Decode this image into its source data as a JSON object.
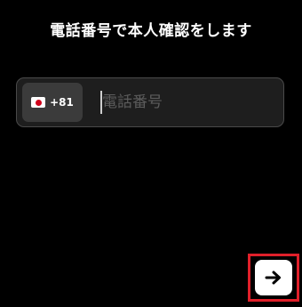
{
  "header": {
    "title": "電話番号で本人確認をします"
  },
  "phone": {
    "country": {
      "flag_icon": "japan-flag-icon",
      "dial_code": "+81"
    },
    "input": {
      "placeholder": "電話番号",
      "value": ""
    }
  },
  "actions": {
    "next_icon": "arrow-right-icon",
    "highlight_color": "#e0202a"
  }
}
